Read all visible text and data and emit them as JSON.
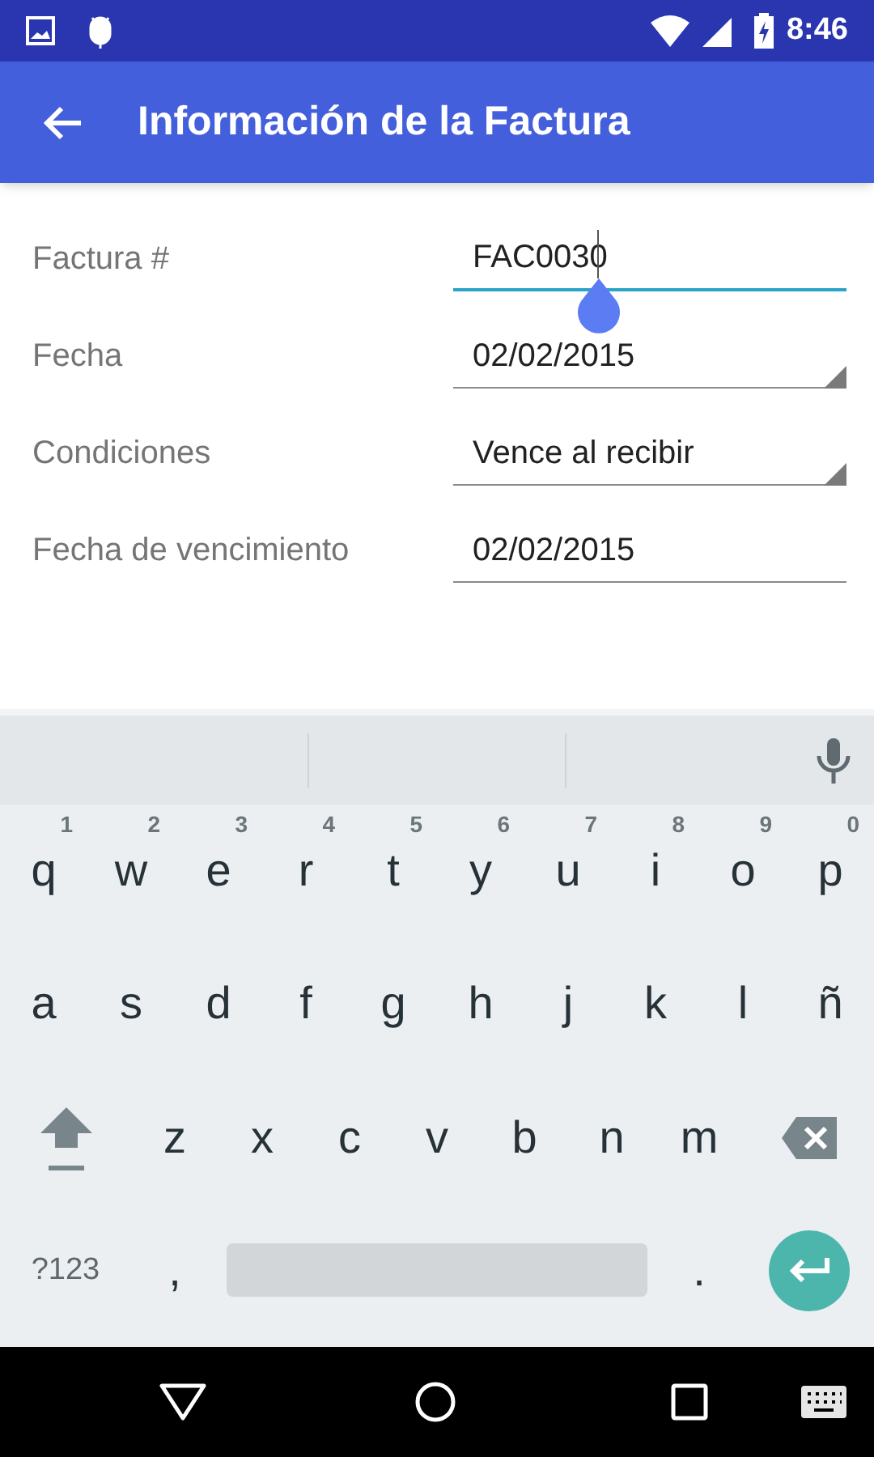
{
  "status_bar": {
    "time": "8:46"
  },
  "app_bar": {
    "title": "Información de la Factura"
  },
  "form": {
    "fields": [
      {
        "label": "Factura #",
        "value": "FAC0030",
        "kind": "text",
        "focused": true
      },
      {
        "label": "Fecha",
        "value": "02/02/2015",
        "kind": "dropdown",
        "focused": false
      },
      {
        "label": "Condiciones",
        "value": "Vence al recibir",
        "kind": "dropdown",
        "focused": false
      },
      {
        "label": "Fecha de vencimiento",
        "value": "02/02/2015",
        "kind": "text",
        "focused": false
      }
    ]
  },
  "keyboard": {
    "rows": [
      [
        {
          "kind": "letter",
          "label": "q",
          "hint": "1"
        },
        {
          "kind": "letter",
          "label": "w",
          "hint": "2"
        },
        {
          "kind": "letter",
          "label": "e",
          "hint": "3"
        },
        {
          "kind": "letter",
          "label": "r",
          "hint": "4"
        },
        {
          "kind": "letter",
          "label": "t",
          "hint": "5"
        },
        {
          "kind": "letter",
          "label": "y",
          "hint": "6"
        },
        {
          "kind": "letter",
          "label": "u",
          "hint": "7"
        },
        {
          "kind": "letter",
          "label": "i",
          "hint": "8"
        },
        {
          "kind": "letter",
          "label": "o",
          "hint": "9"
        },
        {
          "kind": "letter",
          "label": "p",
          "hint": "0"
        }
      ],
      [
        {
          "kind": "letter",
          "label": "a"
        },
        {
          "kind": "letter",
          "label": "s"
        },
        {
          "kind": "letter",
          "label": "d"
        },
        {
          "kind": "letter",
          "label": "f"
        },
        {
          "kind": "letter",
          "label": "g"
        },
        {
          "kind": "letter",
          "label": "h"
        },
        {
          "kind": "letter",
          "label": "j"
        },
        {
          "kind": "letter",
          "label": "k"
        },
        {
          "kind": "letter",
          "label": "l"
        },
        {
          "kind": "letter",
          "label": "ñ"
        }
      ],
      [
        {
          "kind": "shift"
        },
        {
          "kind": "letter",
          "label": "z"
        },
        {
          "kind": "letter",
          "label": "x"
        },
        {
          "kind": "letter",
          "label": "c"
        },
        {
          "kind": "letter",
          "label": "v"
        },
        {
          "kind": "letter",
          "label": "b"
        },
        {
          "kind": "letter",
          "label": "n"
        },
        {
          "kind": "letter",
          "label": "m"
        },
        {
          "kind": "backspace"
        }
      ],
      [
        {
          "kind": "symbols",
          "label": "?123"
        },
        {
          "kind": "letter",
          "label": ","
        },
        {
          "kind": "space"
        },
        {
          "kind": "letter",
          "label": "."
        },
        {
          "kind": "enter"
        }
      ]
    ]
  }
}
